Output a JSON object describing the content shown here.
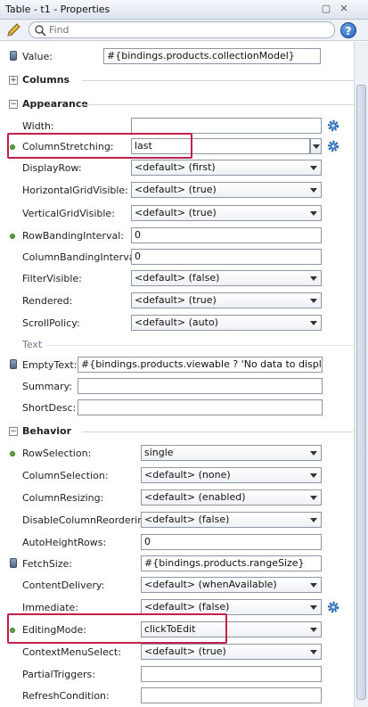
{
  "window": {
    "title": "Table - t1 - Properties"
  },
  "search": {
    "placeholder": "Find"
  },
  "help": {
    "glyph": "?"
  },
  "properties": {
    "value": {
      "label": "Value:",
      "value": "#{bindings.products.collectionModel}"
    },
    "columns": {
      "label": "Columns"
    },
    "appearance": {
      "label": "Appearance",
      "width": {
        "label": "Width:",
        "value": ""
      },
      "column_stretching": {
        "label": "ColumnStretching:",
        "value": "last"
      },
      "display_row": {
        "label": "DisplayRow:",
        "value": "<default> (first)"
      },
      "horizontal_grid": {
        "label": "HorizontalGridVisible:",
        "value": "<default> (true)"
      },
      "vertical_grid": {
        "label": "VerticalGridVisible:",
        "value": "<default> (true)"
      },
      "row_banding": {
        "label": "RowBandingInterval:",
        "value": "0"
      },
      "column_banding": {
        "label": "ColumnBandingInterval:",
        "value": "0"
      },
      "filter_visible": {
        "label": "FilterVisible:",
        "value": "<default> (false)"
      },
      "rendered": {
        "label": "Rendered:",
        "value": "<default> (true)"
      },
      "scroll_policy": {
        "label": "ScrollPolicy:",
        "value": "<default> (auto)"
      }
    },
    "text": {
      "label": "Text",
      "empty_text": {
        "label": "EmptyText:",
        "value": "#{bindings.products.viewable ? 'No data to display.' :..."
      },
      "summary": {
        "label": "Summary:",
        "value": ""
      },
      "short_desc": {
        "label": "ShortDesc:",
        "value": ""
      }
    },
    "behavior": {
      "label": "Behavior",
      "row_selection": {
        "label": "RowSelection:",
        "value": "single"
      },
      "column_selection": {
        "label": "ColumnSelection:",
        "value": "<default> (none)"
      },
      "column_resizing": {
        "label": "ColumnResizing:",
        "value": "<default> (enabled)"
      },
      "disable_column_reordering": {
        "label": "DisableColumnReordering:",
        "value": "<default> (false)"
      },
      "auto_height_rows": {
        "label": "AutoHeightRows:",
        "value": "0"
      },
      "fetch_size": {
        "label": "FetchSize:",
        "value": "#{bindings.products.rangeSize}"
      },
      "content_delivery": {
        "label": "ContentDelivery:",
        "value": "<default> (whenAvailable)"
      },
      "immediate": {
        "label": "Immediate:",
        "value": "<default> (false)"
      },
      "editing_mode": {
        "label": "EditingMode:",
        "value": "clickToEdit"
      },
      "context_menu_select": {
        "label": "ContextMenuSelect:",
        "value": "<default> (true)"
      },
      "partial_triggers": {
        "label": "PartialTriggers:",
        "value": ""
      },
      "refresh_condition": {
        "label": "RefreshCondition:",
        "value": ""
      }
    }
  },
  "colors": {
    "highlight": "#c4204a",
    "accent_dot": "#5da33a"
  }
}
